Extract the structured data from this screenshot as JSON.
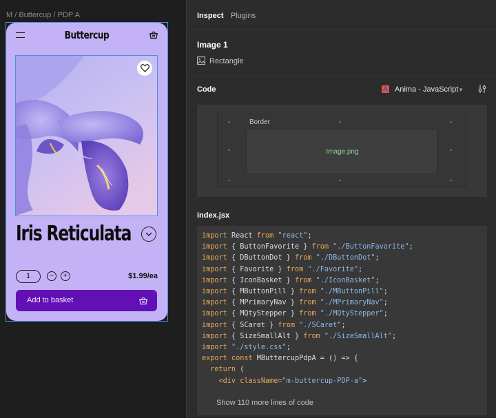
{
  "canvas": {
    "frame_label": "M / Buttercup / PDP A"
  },
  "app": {
    "brand": "Buttercup",
    "product_title": "Iris Reticulata",
    "quantity": "1",
    "minus": "−",
    "plus": "+",
    "price": "$1.99/ea",
    "add_to_basket": "Add to basket",
    "colors": {
      "background": "#c4b2f7",
      "button": "#6210b5"
    }
  },
  "inspector": {
    "tabs": [
      "Inspect",
      "Plugins"
    ],
    "layer_name": "Image 1",
    "layer_type": "Rectangle",
    "code_heading": "Code",
    "framework": "Anima - JavaScript",
    "box_model": {
      "label": "Border",
      "content": "Image.png",
      "dash": "-"
    },
    "file_name": "index.jsx",
    "code_lines": [
      [
        "import",
        " React ",
        "from",
        " \"react\"",
        ";"
      ],
      [
        "import",
        " { ButtonFavorite } ",
        "from",
        " \"./ButtonFavorite\"",
        ";"
      ],
      [
        "import",
        " { DButtonDot } ",
        "from",
        " \"./DButtonDot\"",
        ";"
      ],
      [
        "import",
        " { Favorite } ",
        "from",
        " \"./Favorite\"",
        ";"
      ],
      [
        "import",
        " { IconBasket } ",
        "from",
        " \"./IconBasket\"",
        ";"
      ],
      [
        "import",
        " { MButtonPill } ",
        "from",
        " \"./MButtonPill\"",
        ";"
      ],
      [
        "import",
        " { MPrimaryNav } ",
        "from",
        " \"./MPrimaryNav\"",
        ";"
      ],
      [
        "import",
        " { MQtyStepper } ",
        "from",
        " \"./MQtyStepper\"",
        ";"
      ],
      [
        "import",
        " { SCaret } ",
        "from",
        " \"./SCaret\"",
        ";"
      ],
      [
        "import",
        " { SizeSmallAlt } ",
        "from",
        " \"./SizeSmallAlt\"",
        ";"
      ],
      [
        "import",
        " ",
        "",
        "\"./style.css\"",
        ";"
      ],
      [
        "export const",
        " MButtercupPdpA = () => {",
        "",
        "",
        ""
      ],
      [
        "  return",
        " (",
        "",
        "",
        ""
      ],
      [
        "    <div className=",
        "",
        "",
        "\"m-buttercup-PDP-a\"",
        ">"
      ]
    ],
    "more_lines": "Show 110 more lines of code"
  }
}
